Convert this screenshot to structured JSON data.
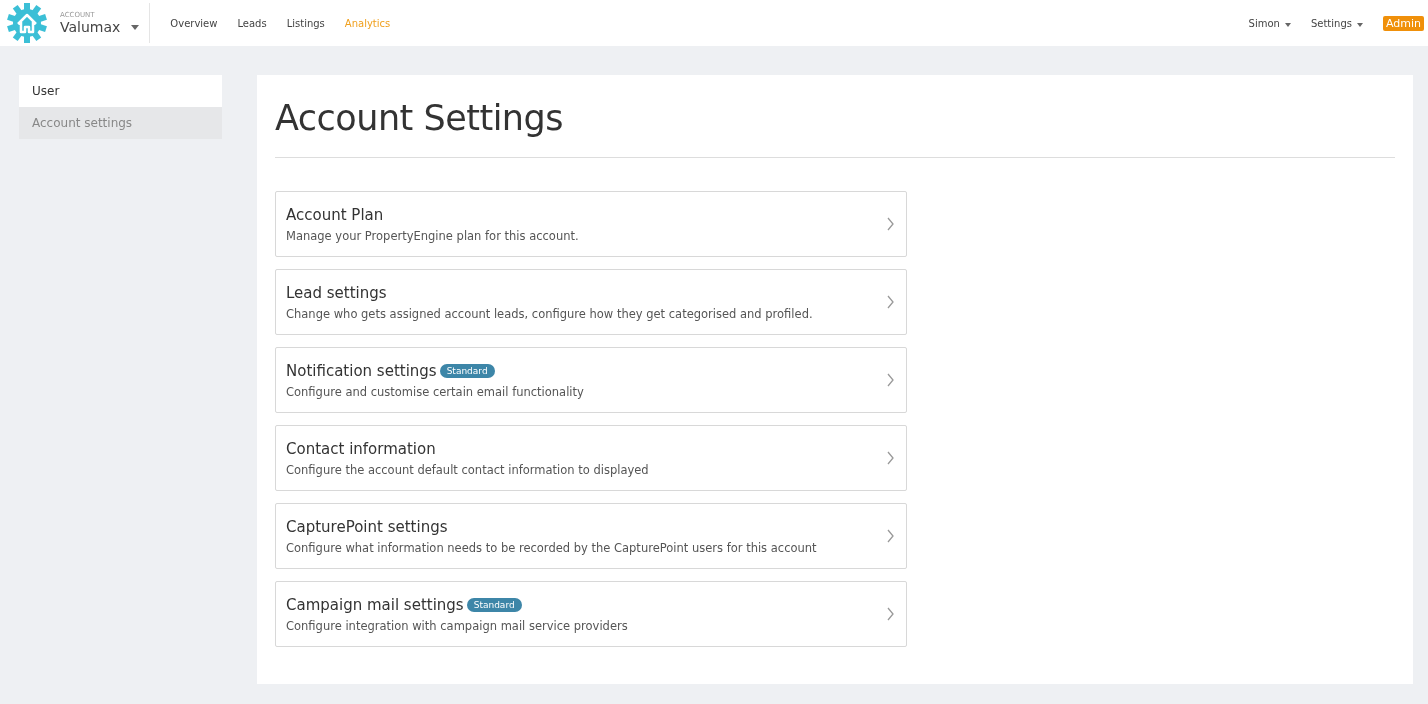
{
  "account": {
    "label": "ACCOUNT",
    "name": "Valumax"
  },
  "nav": [
    {
      "label": "Overview",
      "selected": false
    },
    {
      "label": "Leads",
      "selected": false
    },
    {
      "label": "Listings",
      "selected": false
    },
    {
      "label": "Analytics",
      "selected": true
    }
  ],
  "user_menu": [
    {
      "label": "Simon"
    },
    {
      "label": "Settings"
    }
  ],
  "role_badge": "Admin",
  "sidebar": {
    "items": [
      {
        "label": "User",
        "selected": false
      },
      {
        "label": "Account settings",
        "selected": true
      }
    ]
  },
  "page_title": "Account Settings",
  "settings": [
    {
      "title": "Account Plan",
      "description": "Manage your PropertyEngine plan for this account."
    },
    {
      "title": "Lead settings",
      "description": "Change who gets assigned account leads, configure how they get categorised and profiled."
    },
    {
      "title": "Notification settings",
      "badge": "Standard",
      "description": "Configure and customise certain email functionality"
    },
    {
      "title": "Contact information",
      "description": "Configure the account default contact information to displayed"
    },
    {
      "title": "CapturePoint settings",
      "description": "Configure what information needs to be recorded by the CapturePoint users for this account"
    },
    {
      "title": "Campaign mail settings",
      "badge": "Standard",
      "description": "Configure integration with campaign mail service providers"
    }
  ]
}
